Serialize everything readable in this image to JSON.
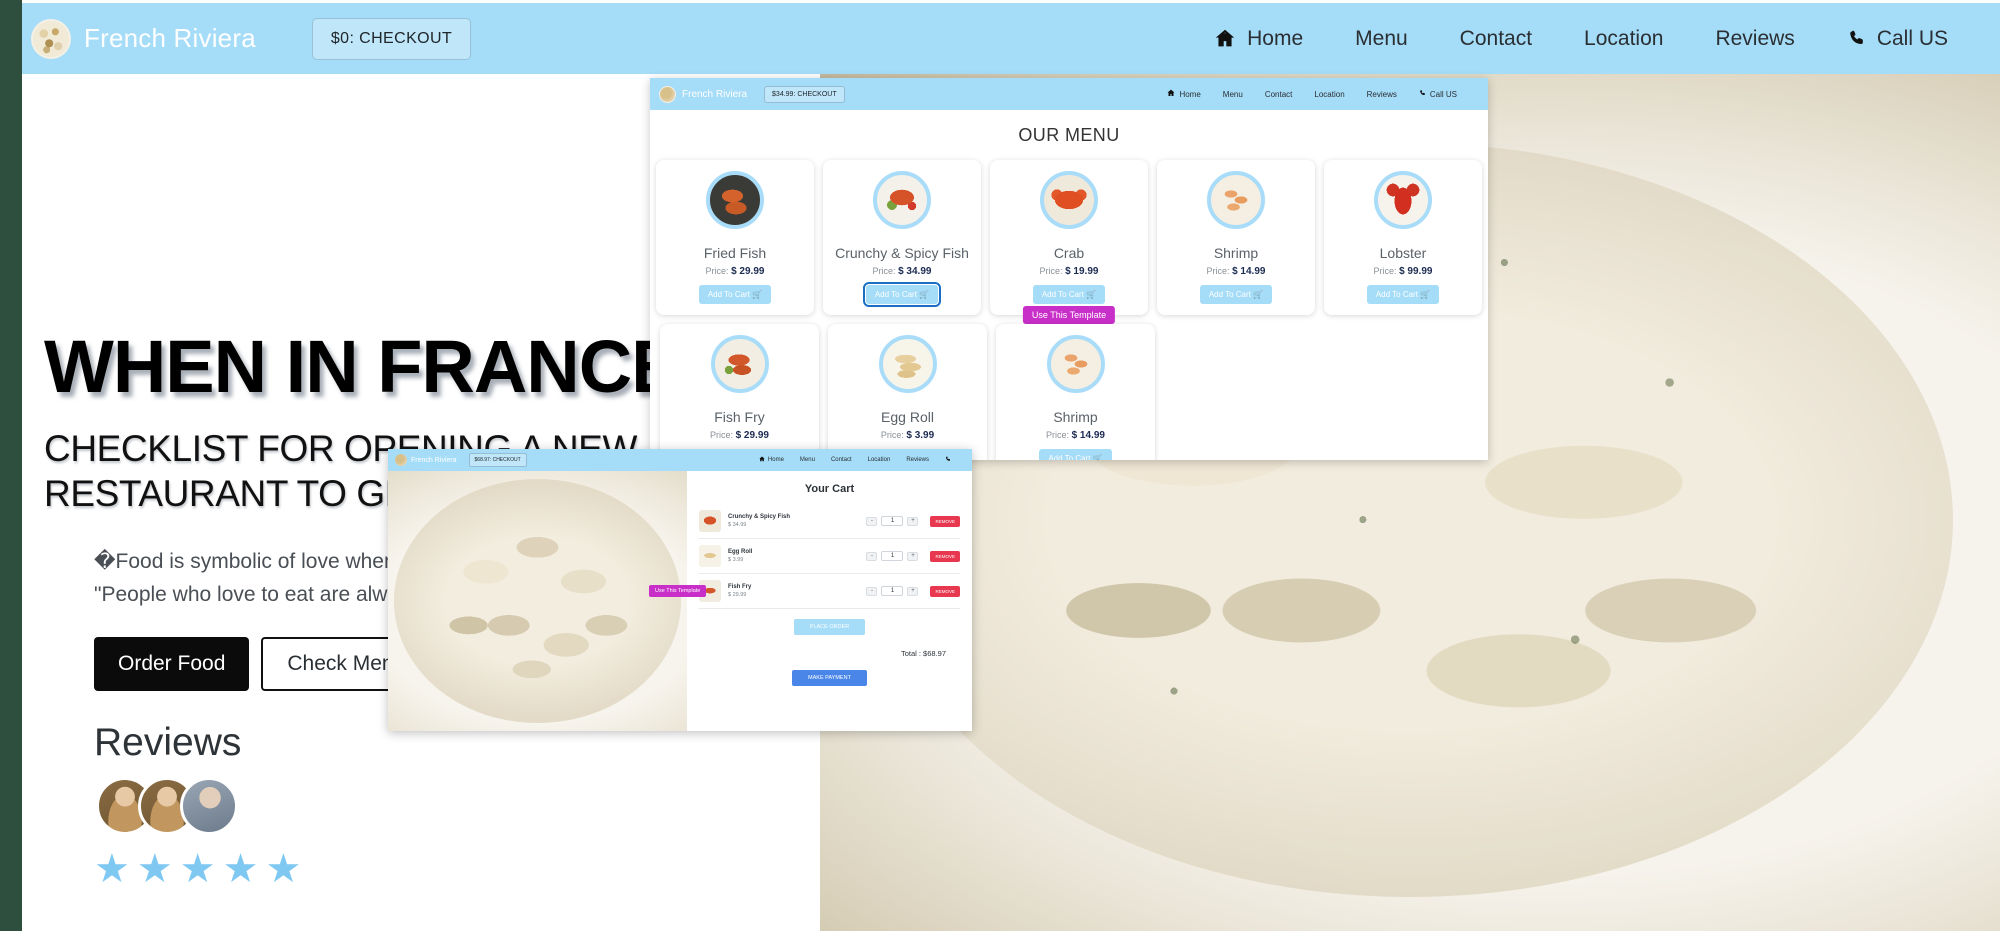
{
  "site": {
    "header": {
      "brand": "French Riviera",
      "checkout_label": "$0:  CHECKOUT",
      "nav": [
        {
          "label": "Home",
          "icon": "home-icon"
        },
        {
          "label": "Menu",
          "icon": null
        },
        {
          "label": "Contact",
          "icon": null
        },
        {
          "label": "Location",
          "icon": null
        },
        {
          "label": "Reviews",
          "icon": null
        },
        {
          "label": "Call US",
          "icon": "phone-icon"
        }
      ]
    },
    "hero": {
      "headline": "WHEN IN FRANCE,",
      "subhead": "CHECKLIST FOR OPENING A NEW RESTAURANT TO GET YOU STARTED!",
      "quote_line1": "�Food is symbolic of love when words are inadequate.�",
      "quote_line2": "\"People who love to eat are always the best people.\"",
      "btn_primary": "Order Food",
      "btn_secondary": "Check Menu",
      "reviews_title": "Reviews",
      "star": "★",
      "star_count": 5,
      "avatars": [
        "avatar-1",
        "avatar-2",
        "avatar-3"
      ]
    }
  },
  "menu_window": {
    "header": {
      "brand": "French Riviera",
      "checkout_label": "$34.99:  CHECKOUT",
      "nav": [
        {
          "label": "Home",
          "icon": "home-icon"
        },
        {
          "label": "Menu",
          "icon": null
        },
        {
          "label": "Contact",
          "icon": null
        },
        {
          "label": "Location",
          "icon": null
        },
        {
          "label": "Reviews",
          "icon": null
        },
        {
          "label": "Call US",
          "icon": "phone-icon"
        }
      ]
    },
    "title": "OUR MENU",
    "price_prefix": "Price:",
    "add_to_cart_label": "Add To Cart",
    "cart_icon": "🛒",
    "use_template_label": "Use This Template",
    "row1": [
      {
        "name": "Fried Fish",
        "price": "$ 29.99",
        "img": "fried-fish-image",
        "focused": false,
        "has_template_badge": false
      },
      {
        "name": "Crunchy & Spicy Fish",
        "price": "$ 34.99",
        "img": "crunchy-spicy-fish-image",
        "focused": true,
        "has_template_badge": false
      },
      {
        "name": "Crab",
        "price": "$ 19.99",
        "img": "crab-image",
        "focused": false,
        "has_template_badge": true
      },
      {
        "name": "Shrimp",
        "price": "$ 14.99",
        "img": "shrimp-image",
        "focused": false,
        "has_template_badge": false
      },
      {
        "name": "Lobster",
        "price": "$ 99.99",
        "img": "lobster-image",
        "focused": false,
        "has_template_badge": false
      }
    ],
    "row2": [
      {
        "name": "Fish Fry",
        "price": "$ 29.99",
        "img": "fish-fry-image",
        "focused": false,
        "has_template_badge": false
      },
      {
        "name": "Egg Roll",
        "price": "$ 3.99",
        "img": "egg-roll-image",
        "focused": false,
        "has_template_badge": false
      },
      {
        "name": "Shrimp",
        "price": "$ 14.99",
        "img": "shrimp-image",
        "focused": false,
        "has_template_badge": false
      }
    ]
  },
  "cart_window": {
    "header": {
      "brand": "French Riviera",
      "checkout_label": "$68.97:  CHECKOUT",
      "nav": [
        {
          "label": "Home",
          "icon": "home-icon"
        },
        {
          "label": "Menu",
          "icon": null
        },
        {
          "label": "Contact",
          "icon": null
        },
        {
          "label": "Location",
          "icon": null
        },
        {
          "label": "Reviews",
          "icon": null
        },
        {
          "label": "",
          "icon": "phone-icon"
        }
      ]
    },
    "title": "Your Cart",
    "dec_label": "-",
    "inc_label": "+",
    "remove_label": "REMOVE",
    "use_template_label": "Use This Template",
    "items": [
      {
        "name": "Crunchy & Spicy Fish",
        "price": "$ 34.99",
        "qty": "1",
        "thumb": "crunchy-spicy-fish-thumb",
        "has_template_badge": false
      },
      {
        "name": "Egg Roll",
        "price": "$ 3.99",
        "qty": "1",
        "thumb": "egg-roll-thumb",
        "has_template_badge": false
      },
      {
        "name": "Fish Fry",
        "price": "$ 29.99",
        "qty": "1",
        "thumb": "fish-fry-thumb",
        "has_template_badge": true
      }
    ],
    "place_order_label": "PLACE ORDER",
    "total_label": "Total : $68.97",
    "make_payment_label": "MAKE PAYMENT",
    "food_photo": "clams-pasta-photo"
  },
  "colors": {
    "brand_blue": "#a5dcf8",
    "magenta_badge": "#c82fc8",
    "remove_red": "#e8384f",
    "payment_blue": "#4a86e8",
    "page_border_green": "#2f4f3e"
  }
}
